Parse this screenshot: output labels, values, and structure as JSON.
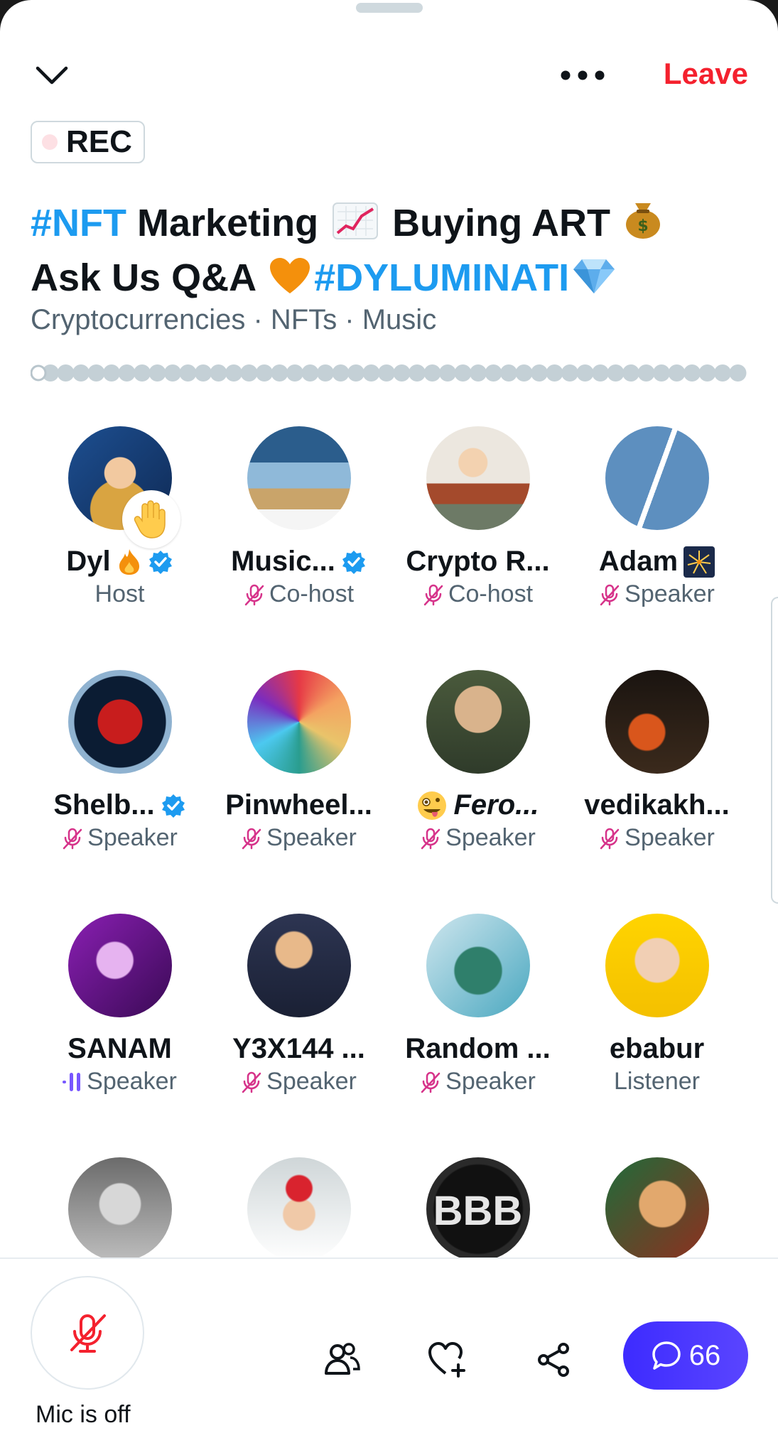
{
  "header": {
    "leave_label": "Leave",
    "rec_label": "REC"
  },
  "space": {
    "title_parts": [
      "#NFT",
      " Marketing ",
      " Buying ART ",
      "Ask Us Q&A ",
      "#DYLUMINATI"
    ],
    "topics": "Cryptocurrencies · NFTs · Music"
  },
  "participants": [
    {
      "name": "Dyl",
      "role": "Host",
      "verified": true,
      "mic": "none",
      "emoji": "fire"
    },
    {
      "name": "Music...",
      "role": "Co-host",
      "verified": true,
      "mic": "muted"
    },
    {
      "name": "Crypto R...",
      "role": "Co-host",
      "verified": false,
      "mic": "muted"
    },
    {
      "name": "Adam",
      "role": "Speaker",
      "verified": false,
      "mic": "muted",
      "emoji": "fireworks"
    },
    {
      "name": "Shelb...",
      "role": "Speaker",
      "verified": true,
      "mic": "muted"
    },
    {
      "name": "Pinwheel...",
      "role": "Speaker",
      "verified": false,
      "mic": "muted"
    },
    {
      "name": "Fero...",
      "role": "Speaker",
      "verified": false,
      "mic": "muted",
      "emoji": "zany"
    },
    {
      "name": "vedikakh...",
      "role": "Speaker",
      "verified": false,
      "mic": "muted"
    },
    {
      "name": "SANAM",
      "role": "Speaker",
      "verified": false,
      "mic": "talking",
      "hand_raised": true
    },
    {
      "name": "Y3X144 ...",
      "role": "Speaker",
      "verified": false,
      "mic": "muted"
    },
    {
      "name": "Random ...",
      "role": "Speaker",
      "verified": false,
      "mic": "muted"
    },
    {
      "name": "ebabur",
      "role": "Listener",
      "verified": false,
      "mic": "none"
    },
    {
      "name": "",
      "role": "",
      "partial": true
    },
    {
      "name": "",
      "role": "",
      "partial": true
    },
    {
      "name": "BBB",
      "role": "",
      "partial": true
    },
    {
      "name": "",
      "role": "",
      "partial": true
    }
  ],
  "bottom": {
    "mic_label": "Mic is off",
    "chat_count": "66"
  },
  "colors": {
    "accent_blue": "#1d9bf0",
    "leave_red": "#f4212e",
    "mic_muted_pink": "#d6338a",
    "chat_pill": "#4a37ff"
  }
}
